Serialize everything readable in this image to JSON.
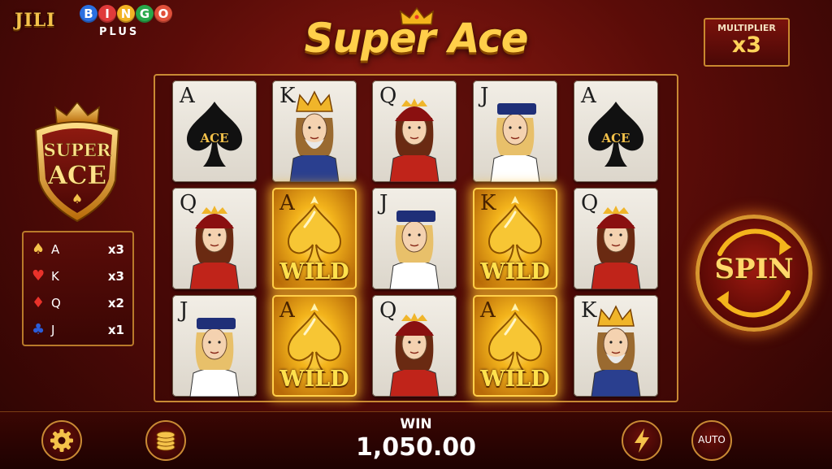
{
  "brand": {
    "jili": "JILI",
    "bingo_letters": [
      "B",
      "I",
      "N",
      "G",
      "O"
    ],
    "bingo_colors": [
      "#2a6fe0",
      "#e03a3a",
      "#f2b324",
      "#28a84a",
      "#e0503a"
    ],
    "plus": "PLUS"
  },
  "title": "Super Ace",
  "multiplier": {
    "label": "MULTIPLIER",
    "value": "x3"
  },
  "badge": {
    "line1": "SUPER",
    "line2": "ACE"
  },
  "paytable": [
    {
      "suit": "♠",
      "suit_color": "#f4c24a",
      "rank": "A",
      "mult": "x3"
    },
    {
      "suit": "♥",
      "suit_color": "#e8322a",
      "rank": "K",
      "mult": "x3"
    },
    {
      "suit": "♦",
      "suit_color": "#e8322a",
      "rank": "Q",
      "mult": "x2"
    },
    {
      "suit": "♣",
      "suit_color": "#2a5cd8",
      "rank": "J",
      "mult": "x1"
    }
  ],
  "grid": {
    "columns": [
      [
        {
          "rank": "A",
          "kind": "ace",
          "ace_text": "ACE"
        },
        {
          "rank": "Q",
          "kind": "queen"
        },
        {
          "rank": "J",
          "kind": "jack"
        }
      ],
      [
        {
          "rank": "K",
          "kind": "king"
        },
        {
          "rank": "A",
          "kind": "wild",
          "wild_text": "WILD"
        },
        {
          "rank": "A",
          "kind": "wild",
          "wild_text": "WILD"
        }
      ],
      [
        {
          "rank": "Q",
          "kind": "queen"
        },
        {
          "rank": "J",
          "kind": "jack"
        },
        {
          "rank": "Q",
          "kind": "queen"
        }
      ],
      [
        {
          "rank": "J",
          "kind": "jack"
        },
        {
          "rank": "K",
          "kind": "wild",
          "wild_text": "WILD"
        },
        {
          "rank": "A",
          "kind": "wild",
          "wild_text": "WILD"
        }
      ],
      [
        {
          "rank": "A",
          "kind": "ace",
          "ace_text": "ACE"
        },
        {
          "rank": "Q",
          "kind": "queen"
        },
        {
          "rank": "K",
          "kind": "king"
        }
      ]
    ]
  },
  "spin": {
    "label": "SPIN"
  },
  "win": {
    "label": "WIN",
    "value": "1,050.00"
  },
  "buttons": {
    "settings_icon": "gear-icon",
    "coins_icon": "coins-icon",
    "turbo_icon": "lightning-icon",
    "auto_label": "AUTO"
  },
  "colors": {
    "gold": "#ffcf4a",
    "dark_red": "#5a0c08",
    "border_gold": "#c98a34"
  }
}
